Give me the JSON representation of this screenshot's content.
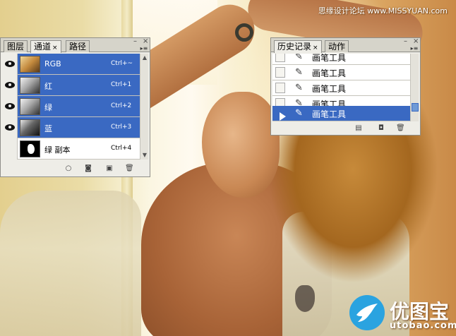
{
  "watermark": {
    "top_right": "思缘设计论坛 www.MISSYUAN.com",
    "logo_cn": "优图宝",
    "logo_en": "utobao.com"
  },
  "channels_panel": {
    "tabs": [
      {
        "label": "图层"
      },
      {
        "label": "通道",
        "close": "×"
      },
      {
        "label": "路径"
      }
    ],
    "panel_controls": {
      "minimize": "–",
      "close": "×",
      "menu": "▸≡"
    },
    "channels": [
      {
        "name": "RGB",
        "shortcut": "Ctrl+~",
        "visible": true,
        "selected": true,
        "thumb": "color"
      },
      {
        "name": "红",
        "shortcut": "Ctrl+1",
        "visible": true,
        "selected": true,
        "thumb": "gray"
      },
      {
        "name": "绿",
        "shortcut": "Ctrl+2",
        "visible": true,
        "selected": true,
        "thumb": "gray"
      },
      {
        "name": "蓝",
        "shortcut": "Ctrl+3",
        "visible": true,
        "selected": true,
        "thumb": "dark"
      },
      {
        "name": "绿 副本",
        "shortcut": "Ctrl+4",
        "visible": false,
        "selected": false,
        "thumb": "mask"
      }
    ],
    "footer_icons": [
      "load-selection-icon",
      "save-selection-icon",
      "new-channel-icon",
      "delete-channel-icon"
    ]
  },
  "history_panel": {
    "tabs": [
      {
        "label": "历史记录",
        "close": "×"
      },
      {
        "label": "动作"
      }
    ],
    "panel_controls": {
      "minimize": "–",
      "close": "×",
      "menu": "▸≡"
    },
    "states": [
      {
        "label": "画笔工具",
        "selected": false
      },
      {
        "label": "画笔工具",
        "selected": false
      },
      {
        "label": "画笔工具",
        "selected": false
      },
      {
        "label": "画笔工具",
        "selected": false
      },
      {
        "label": "画笔工具",
        "selected": true
      }
    ],
    "footer_icons": [
      "new-document-icon",
      "new-snapshot-icon",
      "delete-state-icon"
    ]
  },
  "colors": {
    "selection": "#3a69c2",
    "panel_bg": "#eeede7",
    "logo_blue": "#2aa3e0"
  }
}
